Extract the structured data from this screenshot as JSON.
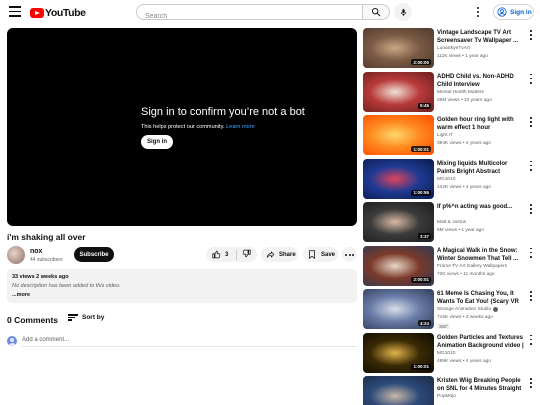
{
  "header": {
    "logo_text": "YouTube",
    "search_placeholder": "Search",
    "signin_label": "Sign in"
  },
  "player": {
    "prompt_title": "Sign in to confirm you’re not a bot",
    "prompt_sub": "This helps protect our community.",
    "learn_more": "Learn more",
    "signin_button": "Sign in"
  },
  "video": {
    "title": "i'm shaking all over",
    "channel": "nox",
    "subscribers": "44 subscribers",
    "subscribe_label": "Subscribe",
    "likes": "3",
    "share_label": "Share",
    "save_label": "Save"
  },
  "description": {
    "stats": "33 views  2 weeks ago",
    "text": "No description has been added to this video.",
    "more": "...more"
  },
  "comments": {
    "count": "0 Comments",
    "sort_label": "Sort by",
    "add_placeholder": "Add a comment..."
  },
  "recommendations": [
    {
      "title": "Vintage Landscape TV Art Screensaver Tv Wallpaper ...",
      "channel": "LunaSkyeTvArt",
      "meta": "111K views • 1 year ago",
      "duration": "2:00:00",
      "verified": false,
      "badge": "",
      "colors": [
        "#7a5a44",
        "#c9a884",
        "#4e3a2d"
      ]
    },
    {
      "title": "ADHD Child vs. Non-ADHD Child Interview",
      "channel": "Mental Health Matters",
      "meta": "26M views • 10 years ago",
      "duration": "5:45",
      "verified": false,
      "badge": "",
      "colors": [
        "#b83a3a",
        "#f0e1d8",
        "#6a1e1e"
      ]
    },
    {
      "title": "Golden hour ring light with warm effect 1 hour",
      "channel": "Light IT",
      "meta": "394K views • 2 years ago",
      "duration": "1:00:01",
      "verified": false,
      "badge": "",
      "colors": [
        "#ff8a1f",
        "#ffd76b",
        "#ff4b00"
      ]
    },
    {
      "title": "Mixing liquids Multicolor Paints Bright Abstract Background ...",
      "channel": "MG1010",
      "meta": "132K views • 4 years ago",
      "duration": "1:00:55",
      "verified": false,
      "badge": "",
      "colors": [
        "#1f3a93",
        "#e0445c",
        "#0b1b4d"
      ]
    },
    {
      "title": "If p%^n acting was good...",
      "channel": "Matt & Justus",
      "meta": "5M views • 1 year ago",
      "duration": "3:37",
      "verified": false,
      "badge": "",
      "colors": [
        "#3b3b3b",
        "#d9b9a3",
        "#1c1c1c"
      ]
    },
    {
      "title": "A Magical Walk in the Snow: Winter Snowmen That Tell ...",
      "channel": "Frame TV Art Gallery Wallpapers",
      "meta": "72K views • 11 months ago",
      "duration": "2:00:01",
      "verified": false,
      "badge": "",
      "colors": [
        "#7b3a2a",
        "#e9d8c6",
        "#2d3a55"
      ]
    },
    {
      "title": "61 Meme Is Chasing You, It Wants To Eat You! (Scary VR ...",
      "channel": "Strange Animation Studio",
      "meta": "715K views • 2 weeks ago",
      "duration": "4:24",
      "verified": true,
      "badge": "360°",
      "colors": [
        "#6a7da8",
        "#d7dde9",
        "#2e3a58"
      ]
    },
    {
      "title": "Golden Particles and Textures Animation Background video | ...",
      "channel": "MG1010",
      "meta": "489K views • 4 years ago",
      "duration": "1:00:01",
      "verified": false,
      "badge": "",
      "colors": [
        "#3a2a05",
        "#e2b34a",
        "#0e0a02"
      ]
    },
    {
      "title": "Kristen Wiig Breaking People on SNL for 4 Minutes Straight",
      "channel": "PopMojo",
      "meta": "",
      "duration": "",
      "verified": false,
      "badge": "",
      "colors": [
        "#2d4a7a",
        "#c8b8a6",
        "#1a2a45"
      ]
    }
  ]
}
